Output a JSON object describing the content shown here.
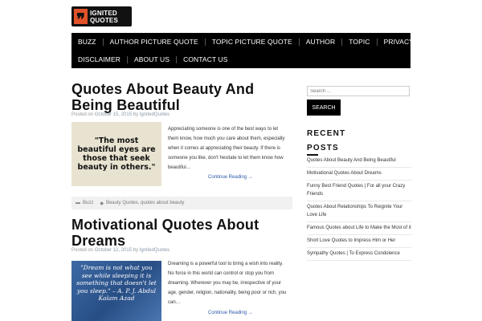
{
  "logo": {
    "line1": "IGNITED",
    "line2": "QUOTES",
    "mark": "❞"
  },
  "nav": {
    "row1": [
      "BUZZ",
      "AUTHOR PICTURE QUOTE",
      "TOPIC PICTURE QUOTE",
      "AUTHOR",
      "TOPIC",
      "PRIVACY POLICY"
    ],
    "row2": [
      "DISCLAIMER",
      "ABOUT US",
      "CONTACT US"
    ]
  },
  "posts": [
    {
      "title_line1": "Quotes About Beauty And",
      "title_line2": "Being Beautiful",
      "meta_prefix": "Posted on",
      "date": "October 15, 2015",
      "meta_by": "by",
      "author": "IgnitedQuotes",
      "image_text": "\"The most beautiful eyes are those that seek beauty in others.\"",
      "excerpt": "Appreciating someone is one of the best ways to let them know, how much you care about them, especially when it comes at appreciating their beauty. If there is someone you like, don't hesitate to let them know how beautiful…",
      "continue": "Continue Reading →",
      "category": "Buzz",
      "tags": "Beauty Quotes, quotes about beauty"
    },
    {
      "title_line1": "Motivational Quotes About",
      "title_line2": "Dreams",
      "meta_prefix": "Posted on",
      "date": "October 12, 2015",
      "meta_by": "by",
      "author": "IgnitedQuotes",
      "image_text": "\"Dream is not what you see while sleeping it is something that doesn't let you sleep.\" – A. P. J. Abdul Kalam Azad",
      "excerpt": "Dreaming is a powerful tool to bring a wish into reality. No force in this world can control or stop you from dreaming. Wherever you may be, irrespective of your age, gender, religion, nationality, being poor or rich, you can…",
      "continue": "Continue Reading →"
    }
  ],
  "sidebar": {
    "search_placeholder": "Search ...",
    "search_button": "SEARCH",
    "recent_line1": "RECENT",
    "recent_line2": "POSTS",
    "recent_posts": [
      "Quotes About Beauty And Being Beautiful",
      "Motivational Quotes About Dreams",
      "Funny Best Friend Quotes | For all your Crazy Friends",
      "Quotes About Relationships To Reignite Your Love Life",
      "Famous Quotes about Life to Make the Most of it",
      "Short Love Quotes to Impress Him or Her",
      "Sympathy Quotes | To Express Condolence"
    ]
  },
  "colors": {
    "accent": "#e0522a",
    "link": "#2a59a8",
    "nav_bg": "#000000"
  }
}
